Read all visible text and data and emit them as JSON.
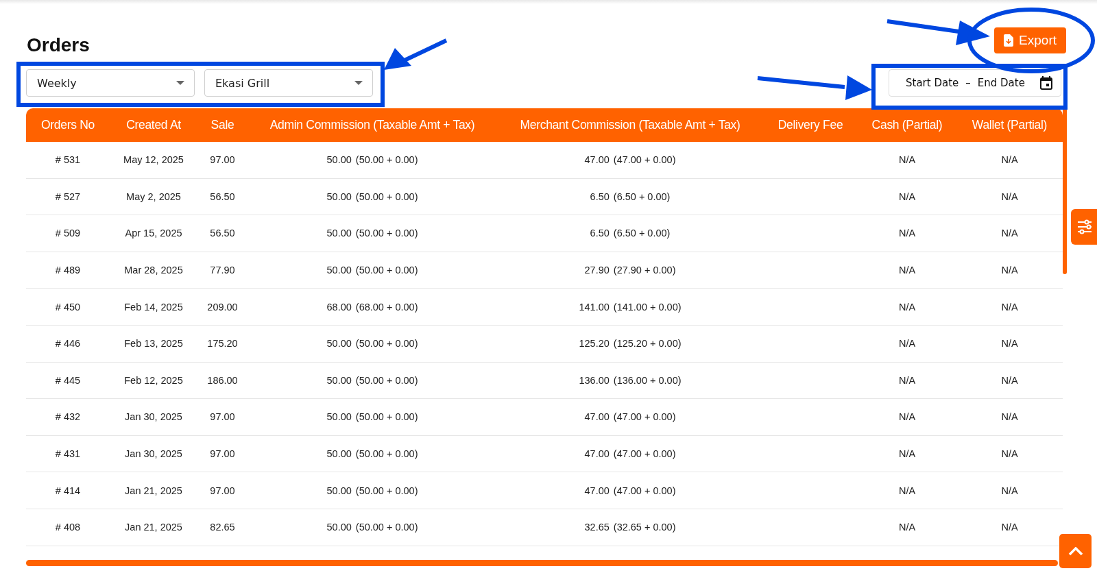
{
  "page": {
    "title": "Orders"
  },
  "filters": [
    {
      "value": "Weekly"
    },
    {
      "value": "Ekasi Grill"
    }
  ],
  "export_button": {
    "label": "Export"
  },
  "date_range": {
    "start_placeholder": "Start Date",
    "separator": "–",
    "end_placeholder": "End Date"
  },
  "table": {
    "columns": [
      "Orders No",
      "Created At",
      "Sale",
      "Admin Commission (Taxable Amt + Tax)",
      "Merchant Commission (Taxable Amt + Tax)",
      "Delivery Fee",
      "Cash (Partial)",
      "Wallet (Partial)"
    ],
    "rows": [
      {
        "order_no": "# 531",
        "created_at": "May 12, 2025",
        "sale": "97.00",
        "admin_amount": "50.00",
        "admin_breakdown": "(50.00 + 0.00)",
        "merchant_amount": "47.00",
        "merchant_breakdown": "(47.00 + 0.00)",
        "cash": "N/A",
        "wallet": "N/A"
      },
      {
        "order_no": "# 527",
        "created_at": "May 2, 2025",
        "sale": "56.50",
        "admin_amount": "50.00",
        "admin_breakdown": "(50.00 + 0.00)",
        "merchant_amount": "6.50",
        "merchant_breakdown": "(6.50 + 0.00)",
        "cash": "N/A",
        "wallet": "N/A"
      },
      {
        "order_no": "# 509",
        "created_at": "Apr 15, 2025",
        "sale": "56.50",
        "admin_amount": "50.00",
        "admin_breakdown": "(50.00 + 0.00)",
        "merchant_amount": "6.50",
        "merchant_breakdown": "(6.50 + 0.00)",
        "cash": "N/A",
        "wallet": "N/A"
      },
      {
        "order_no": "# 489",
        "created_at": "Mar 28, 2025",
        "sale": "77.90",
        "admin_amount": "50.00",
        "admin_breakdown": "(50.00 + 0.00)",
        "merchant_amount": "27.90",
        "merchant_breakdown": "(27.90 + 0.00)",
        "cash": "N/A",
        "wallet": "N/A"
      },
      {
        "order_no": "# 450",
        "created_at": "Feb 14, 2025",
        "sale": "209.00",
        "admin_amount": "68.00",
        "admin_breakdown": "(68.00 + 0.00)",
        "merchant_amount": "141.00",
        "merchant_breakdown": "(141.00 + 0.00)",
        "cash": "N/A",
        "wallet": "N/A"
      },
      {
        "order_no": "# 446",
        "created_at": "Feb 13, 2025",
        "sale": "175.20",
        "admin_amount": "50.00",
        "admin_breakdown": "(50.00 + 0.00)",
        "merchant_amount": "125.20",
        "merchant_breakdown": "(125.20 + 0.00)",
        "cash": "N/A",
        "wallet": "N/A"
      },
      {
        "order_no": "# 445",
        "created_at": "Feb 12, 2025",
        "sale": "186.00",
        "admin_amount": "50.00",
        "admin_breakdown": "(50.00 + 0.00)",
        "merchant_amount": "136.00",
        "merchant_breakdown": "(136.00 + 0.00)",
        "cash": "N/A",
        "wallet": "N/A"
      },
      {
        "order_no": "# 432",
        "created_at": "Jan 30, 2025",
        "sale": "97.00",
        "admin_amount": "50.00",
        "admin_breakdown": "(50.00 + 0.00)",
        "merchant_amount": "47.00",
        "merchant_breakdown": "(47.00 + 0.00)",
        "cash": "N/A",
        "wallet": "N/A"
      },
      {
        "order_no": "# 431",
        "created_at": "Jan 30, 2025",
        "sale": "97.00",
        "admin_amount": "50.00",
        "admin_breakdown": "(50.00 + 0.00)",
        "merchant_amount": "47.00",
        "merchant_breakdown": "(47.00 + 0.00)",
        "cash": "N/A",
        "wallet": "N/A"
      },
      {
        "order_no": "# 414",
        "created_at": "Jan 21, 2025",
        "sale": "97.00",
        "admin_amount": "50.00",
        "admin_breakdown": "(50.00 + 0.00)",
        "merchant_amount": "47.00",
        "merchant_breakdown": "(47.00 + 0.00)",
        "cash": "N/A",
        "wallet": "N/A"
      },
      {
        "order_no": "# 408",
        "created_at": "Jan 21, 2025",
        "sale": "82.65",
        "admin_amount": "50.00",
        "admin_breakdown": "(50.00 + 0.00)",
        "merchant_amount": "32.65",
        "merchant_breakdown": "(32.65 + 0.00)",
        "cash": "N/A",
        "wallet": "N/A"
      }
    ]
  }
}
